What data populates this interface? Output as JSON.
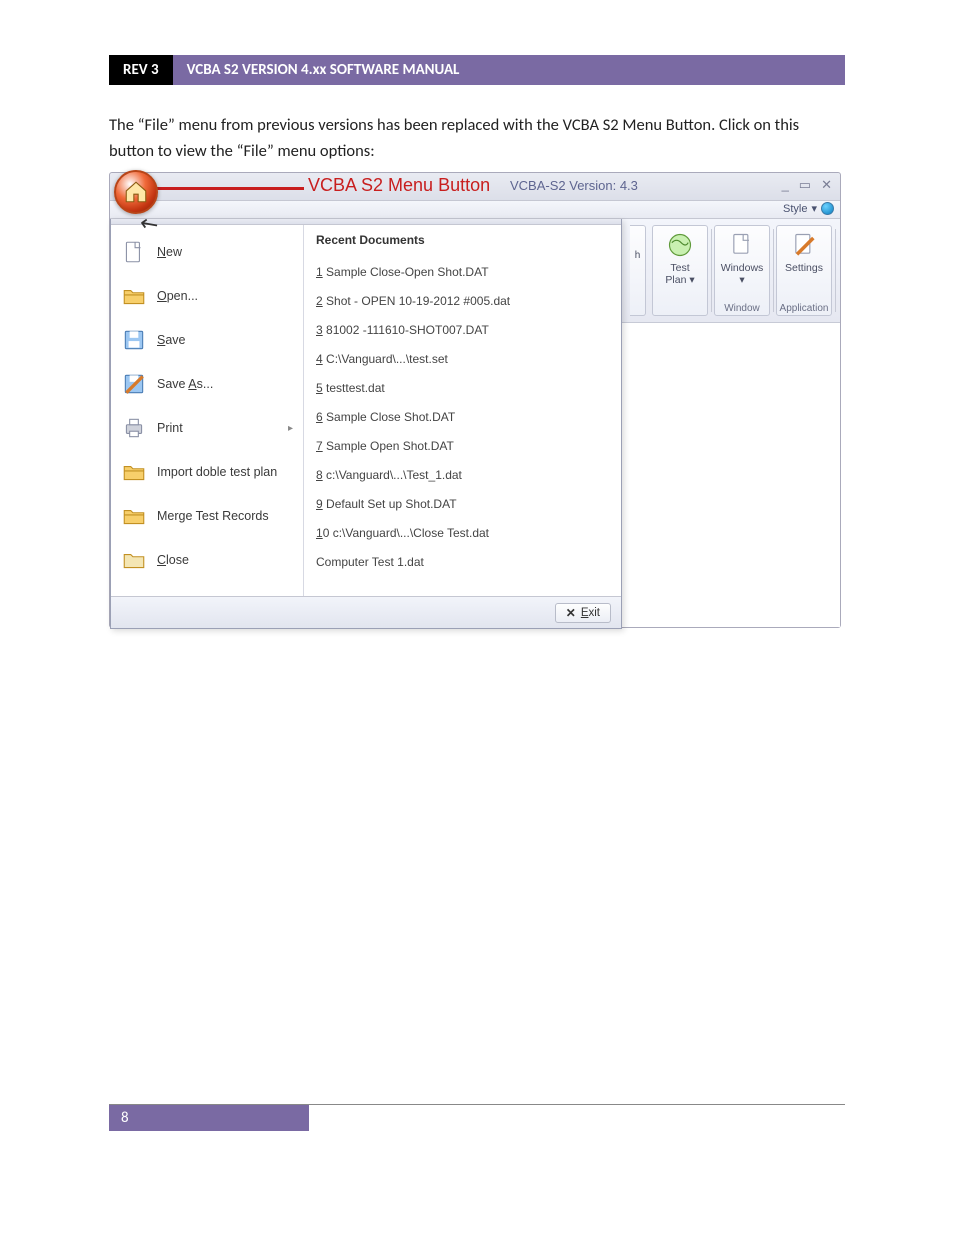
{
  "header": {
    "rev": "REV 3",
    "title": "VCBA S2 VERSION 4.xx SOFTWARE MANUAL"
  },
  "body_text": "The “File” menu from previous versions has been replaced with the VCBA S2 Menu Button. Click on this button to view the “File” menu options:",
  "callouts": {
    "menu_button": "VCBA S2 Menu Button",
    "file_menu": "“File” menu"
  },
  "window": {
    "version": "VCBA-S2 Version: 4.3",
    "style_label": "Style",
    "buttons": {
      "min": "_",
      "max": "▭",
      "close": "✕"
    }
  },
  "menu": {
    "items": [
      {
        "label": "New",
        "u": "N",
        "rest": "ew",
        "icon": "doc"
      },
      {
        "label": "Open...",
        "u": "O",
        "rest": "pen...",
        "icon": "folder"
      },
      {
        "label": "Save",
        "u": "S",
        "rest": "ave",
        "icon": "save"
      },
      {
        "label": "Save As...",
        "u": "A",
        "pre": "Save ",
        "rest": "s...",
        "icon": "saveas"
      },
      {
        "label": "Print",
        "u": "",
        "rest": "Print",
        "icon": "print",
        "submenu": true
      },
      {
        "label": "Import doble test plan",
        "u": "",
        "rest": "Import doble test plan",
        "icon": "folder"
      },
      {
        "label": "Merge Test Records",
        "u": "",
        "rest": "Merge Test Records",
        "icon": "folder"
      },
      {
        "label": "Close",
        "u": "C",
        "rest": "lose",
        "icon": "folder-closed"
      }
    ],
    "recent_header": "Recent Documents",
    "recent": [
      {
        "u": "1",
        "rest": " Sample Close-Open Shot.DAT"
      },
      {
        "u": "2",
        "rest": " Shot - OPEN 10-19-2012 #005.dat"
      },
      {
        "u": "3",
        "rest": " 81002  -111610-SHOT007.DAT"
      },
      {
        "u": "4",
        "rest": " C:\\Vanguard\\...\\test.set"
      },
      {
        "u": "5",
        "rest": " testtest.dat"
      },
      {
        "u": "6",
        "rest": " Sample Close Shot.DAT"
      },
      {
        "u": "7",
        "rest": " Sample Open Shot.DAT"
      },
      {
        "u": "8",
        "rest": " c:\\Vanguard\\...\\Test_1.dat"
      },
      {
        "u": "9",
        "rest": " Default Set up Shot.DAT"
      },
      {
        "u": "1",
        "post_u": "0",
        "rest": " c:\\Vanguard\\...\\Close Test.dat"
      },
      {
        "u": "",
        "rest": "Computer Test 1.dat"
      }
    ],
    "exit": "Exit"
  },
  "ribbon": {
    "partial": "h",
    "btn1_top": "Test",
    "btn1_bot": "Plan ▾",
    "group1": "",
    "btn2_top": "Windows",
    "btn2_bot": "▾",
    "group2": "Window",
    "btn3_top": "Settings",
    "btn3_bot": "",
    "group3": "Application"
  },
  "page_number": "8"
}
